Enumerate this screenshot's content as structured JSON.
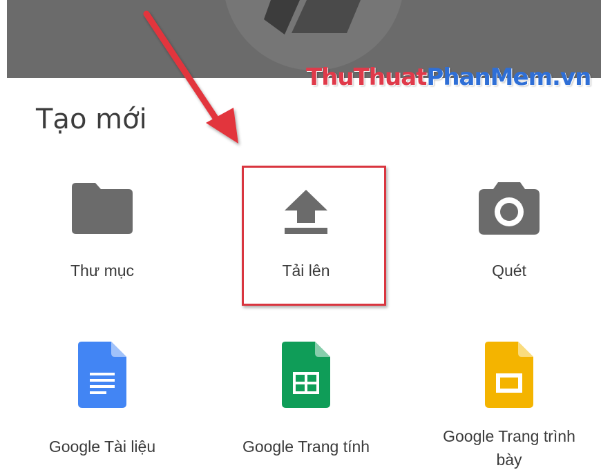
{
  "header": {
    "watermark_part1": "ThuThuat",
    "watermark_part2": "PhanMem.vn"
  },
  "section": {
    "title": "Tạo mới"
  },
  "items": [
    {
      "label": "Thư mục",
      "icon": "folder-icon"
    },
    {
      "label": "Tải lên",
      "icon": "upload-icon"
    },
    {
      "label": "Quét",
      "icon": "camera-icon"
    },
    {
      "label": "Google Tài liệu",
      "icon": "google-docs-icon"
    },
    {
      "label": "Google Trang tính",
      "icon": "google-sheets-icon"
    },
    {
      "label": "Google Trang trình bày",
      "icon": "google-slides-icon"
    }
  ],
  "colors": {
    "icon_gray": "#6b6b6b",
    "docs_blue": "#4285f4",
    "sheets_green": "#0f9d58",
    "slides_yellow": "#f4b400",
    "highlight_red": "#d9353f"
  }
}
